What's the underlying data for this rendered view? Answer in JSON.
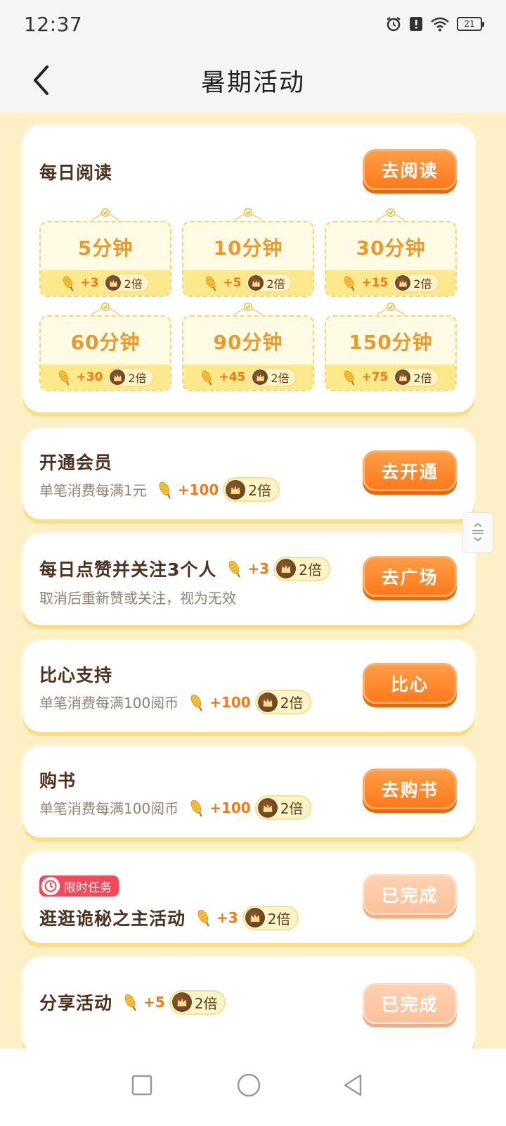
{
  "status_bar": {
    "time": "12:37",
    "battery": "21",
    "icons": [
      "alarm-icon",
      "alert-icon",
      "wifi-icon",
      "battery-icon"
    ]
  },
  "header": {
    "title": "暑期活动",
    "back_icon": "chevron-left-icon"
  },
  "daily_reading": {
    "title": "每日阅读",
    "button": "去阅读",
    "tiles": [
      {
        "label": "5分钟",
        "reward": "+3",
        "multiplier": "2倍"
      },
      {
        "label": "10分钟",
        "reward": "+5",
        "multiplier": "2倍"
      },
      {
        "label": "30分钟",
        "reward": "+15",
        "multiplier": "2倍"
      },
      {
        "label": "60分钟",
        "reward": "+30",
        "multiplier": "2倍"
      },
      {
        "label": "90分钟",
        "reward": "+45",
        "multiplier": "2倍"
      },
      {
        "label": "150分钟",
        "reward": "+75",
        "multiplier": "2倍"
      }
    ]
  },
  "tasks": [
    {
      "title": "开通会员",
      "subtitle": "单笔消费每满1元",
      "reward": "+100",
      "multiplier": "2倍",
      "button": "去开通",
      "done": false
    },
    {
      "title": "每日点赞并关注3个人",
      "subtitle": "取消后重新赞或关注，视为无效",
      "reward": "+3",
      "multiplier": "2倍",
      "button": "去广场",
      "done": false
    },
    {
      "title": "比心支持",
      "subtitle": "单笔消费每满100阅币",
      "reward": "+100",
      "multiplier": "2倍",
      "button": "比心",
      "done": false
    },
    {
      "title": "购书",
      "subtitle": "单笔消费每满100阅币",
      "reward": "+100",
      "multiplier": "2倍",
      "button": "去购书",
      "done": false
    },
    {
      "tag": "限时任务",
      "title": "逛逛诡秘之主活动",
      "reward": "+3",
      "multiplier": "2倍",
      "button": "已完成",
      "done": true
    },
    {
      "title": "分享活动",
      "reward": "+5",
      "multiplier": "2倍",
      "button": "已完成",
      "done": true
    }
  ],
  "colors": {
    "background": "#fdefc6",
    "accent_orange": "#ff7a1c",
    "done_button": "#fcc09a",
    "tile_gold": "#e99a2e",
    "limited_tag": "#f2495b"
  },
  "system_nav": [
    "square-icon",
    "circle-icon",
    "triangle-back-icon"
  ]
}
